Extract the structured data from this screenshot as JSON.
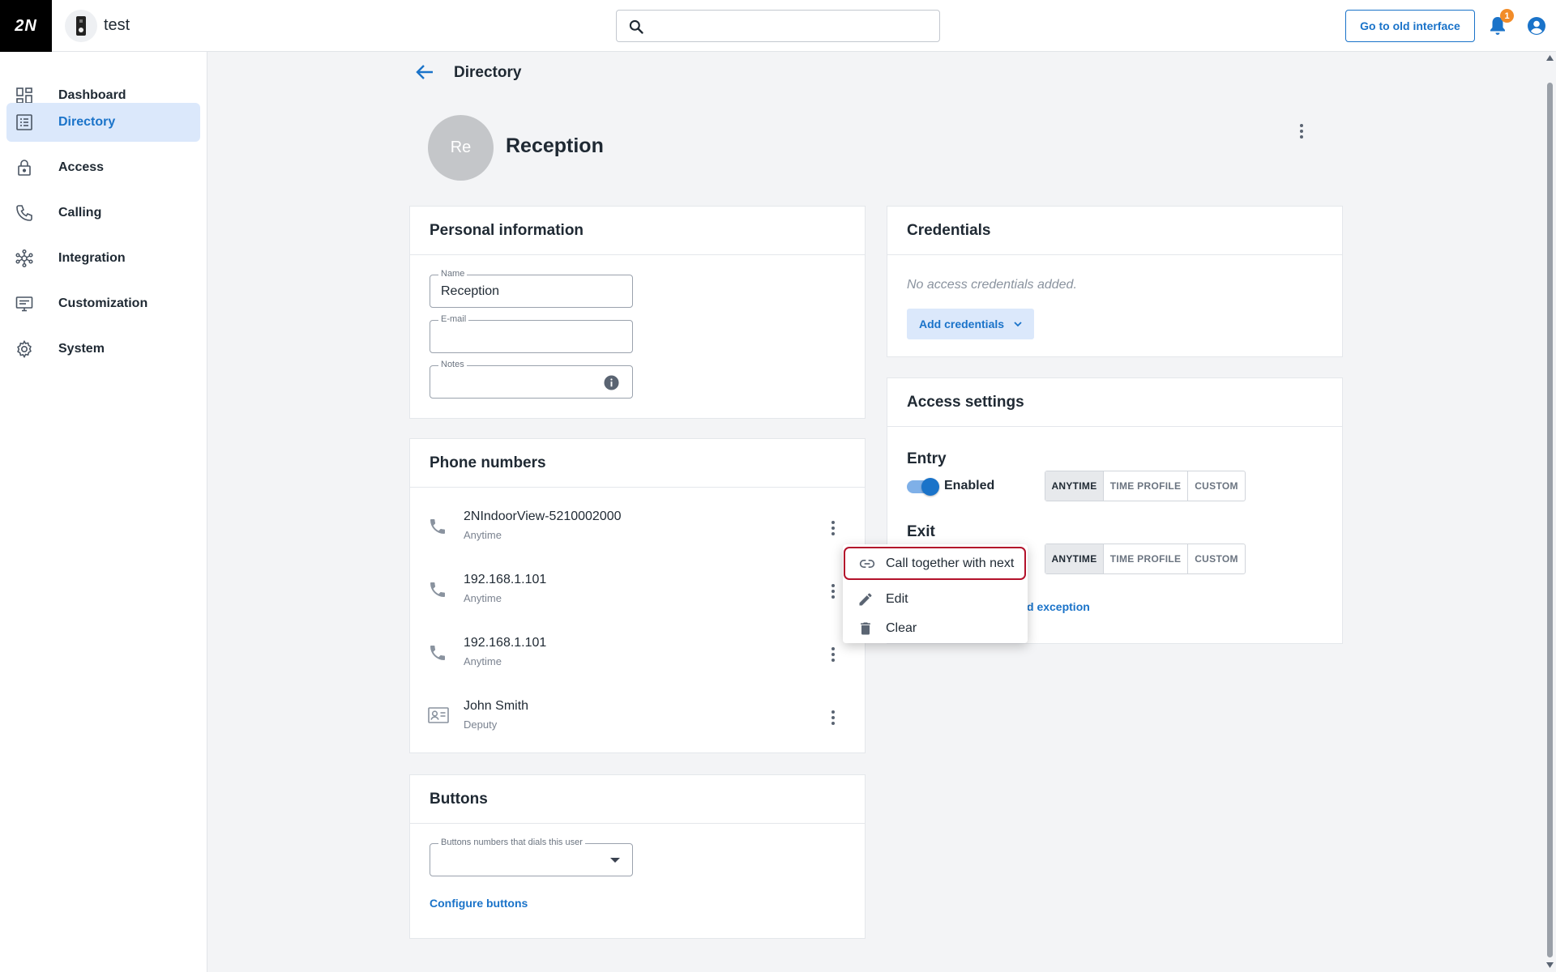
{
  "app": {
    "logo": "2N",
    "title": "test"
  },
  "header": {
    "search_placeholder": "",
    "old_interface_label": "Go to old interface",
    "notification_count": "1"
  },
  "sidebar": {
    "items": [
      {
        "label": "Dashboard",
        "icon": "dashboard-icon",
        "active": false
      },
      {
        "label": "Directory",
        "icon": "directory-icon",
        "active": true
      },
      {
        "label": "Access",
        "icon": "lock-icon",
        "active": false
      },
      {
        "label": "Calling",
        "icon": "phone-icon",
        "active": false
      },
      {
        "label": "Integration",
        "icon": "integration-icon",
        "active": false
      },
      {
        "label": "Customization",
        "icon": "customization-icon",
        "active": false
      },
      {
        "label": "System",
        "icon": "gear-icon",
        "active": false
      }
    ]
  },
  "page": {
    "title": "Directory",
    "user_initials": "Re",
    "user_name": "Reception"
  },
  "personal_info": {
    "title": "Personal information",
    "name_label": "Name",
    "name_value": "Reception",
    "email_label": "E-mail",
    "email_value": "",
    "notes_label": "Notes",
    "notes_value": ""
  },
  "phone_numbers": {
    "title": "Phone numbers",
    "rows": [
      {
        "number": "2NIndoorView-5210002000",
        "sub": "Anytime",
        "icon": "phone-icon"
      },
      {
        "number": "192.168.1.101",
        "sub": "Anytime",
        "icon": "phone-icon"
      },
      {
        "number": "192.168.1.101",
        "sub": "Anytime",
        "icon": "phone-icon"
      },
      {
        "number": "John Smith",
        "sub": "Deputy",
        "icon": "contact-card-icon"
      }
    ]
  },
  "buttons_card": {
    "title": "Buttons",
    "select_label": "Buttons numbers that dials this user",
    "configure_label": "Configure buttons"
  },
  "credentials": {
    "title": "Credentials",
    "empty_text": "No access credentials added.",
    "add_label": "Add credentials"
  },
  "access_settings": {
    "title": "Access settings",
    "entry_label": "Entry",
    "entry_status": "Enabled",
    "exit_label": "Exit",
    "options": [
      "ANYTIME",
      "TIME PROFILE",
      "CUSTOM"
    ],
    "exception_link_partial": "d exception"
  },
  "context_menu": {
    "items": [
      {
        "label": "Call together with next",
        "icon": "link-icon"
      },
      {
        "label": "Edit",
        "icon": "pencil-icon"
      },
      {
        "label": "Clear",
        "icon": "trash-icon"
      }
    ]
  },
  "colors": {
    "accent": "#1a73c9",
    "active_nav_bg": "#dbe8fb",
    "badge": "#f28c28",
    "highlight_border": "#b3122b"
  }
}
